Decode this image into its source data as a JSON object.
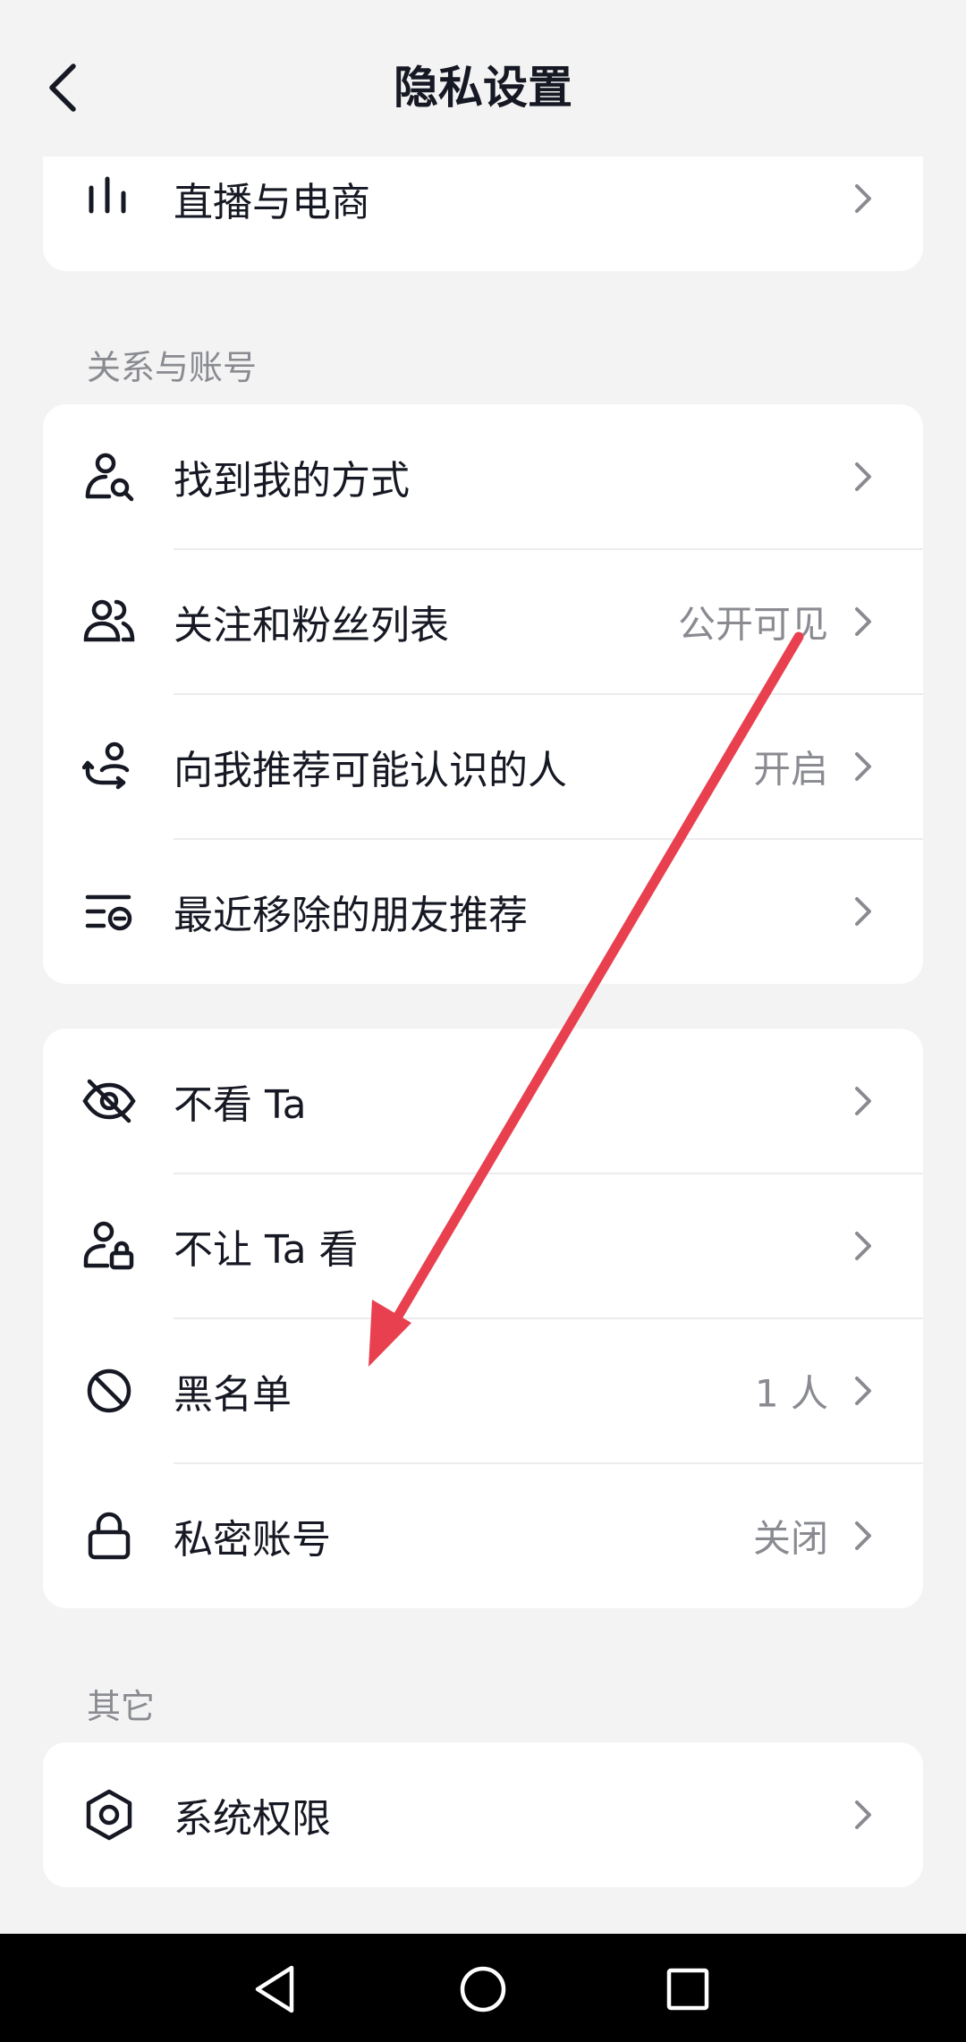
{
  "header": {
    "title": "隐私设置",
    "back_icon": "chevron-left-icon"
  },
  "card_top": {
    "items": [
      {
        "label": "直播与电商",
        "icon": "bar-chart-icon"
      }
    ]
  },
  "section_relations": {
    "title": "关系与账号",
    "items": [
      {
        "label": "找到我的方式",
        "value": "",
        "icon": "user-search-icon"
      },
      {
        "label": "关注和粉丝列表",
        "value": "公开可见",
        "icon": "users-icon"
      },
      {
        "label": "向我推荐可能认识的人",
        "value": "开启",
        "icon": "user-link-icon"
      },
      {
        "label": "最近移除的朋友推荐",
        "value": "",
        "icon": "list-remove-icon"
      }
    ]
  },
  "section_block": {
    "items": [
      {
        "label": "不看 Ta",
        "value": "",
        "icon": "eye-off-icon"
      },
      {
        "label": "不让 Ta 看",
        "value": "",
        "icon": "user-lock-icon"
      },
      {
        "label": "黑名单",
        "value": "1 人",
        "icon": "block-icon"
      },
      {
        "label": "私密账号",
        "value": "关闭",
        "icon": "lock-icon"
      }
    ]
  },
  "section_other": {
    "title": "其它",
    "items": [
      {
        "label": "系统权限",
        "icon": "hexagon-settings-icon"
      }
    ]
  },
  "annotation": {
    "color": "#e8404f"
  },
  "navbar": {
    "back": "nav-back-icon",
    "home": "nav-home-icon",
    "recents": "nav-recents-icon"
  }
}
